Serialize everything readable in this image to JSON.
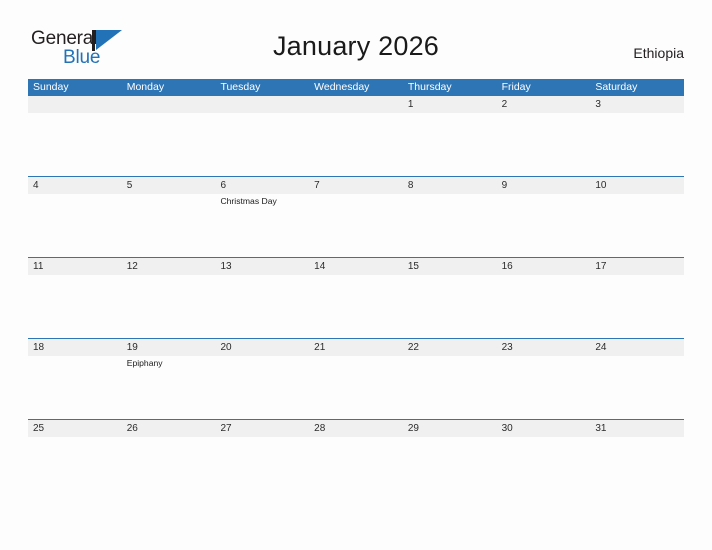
{
  "brand": {
    "name_part1": "General",
    "name_part2": "Blue",
    "flag_color": "#2272b8",
    "text_color": "#231f20"
  },
  "header": {
    "title": "January 2026",
    "locale": "Ethiopia"
  },
  "calendar": {
    "header_bg": "#2e75b6",
    "band_bg": "#f0f0f0",
    "weekdays": [
      "Sunday",
      "Monday",
      "Tuesday",
      "Wednesday",
      "Thursday",
      "Friday",
      "Saturday"
    ],
    "weeks": [
      {
        "days": [
          {
            "number": "",
            "event": ""
          },
          {
            "number": "",
            "event": ""
          },
          {
            "number": "",
            "event": ""
          },
          {
            "number": "",
            "event": ""
          },
          {
            "number": "1",
            "event": ""
          },
          {
            "number": "2",
            "event": ""
          },
          {
            "number": "3",
            "event": ""
          }
        ]
      },
      {
        "days": [
          {
            "number": "4",
            "event": ""
          },
          {
            "number": "5",
            "event": ""
          },
          {
            "number": "6",
            "event": "Christmas Day"
          },
          {
            "number": "7",
            "event": ""
          },
          {
            "number": "8",
            "event": ""
          },
          {
            "number": "9",
            "event": ""
          },
          {
            "number": "10",
            "event": ""
          }
        ]
      },
      {
        "days": [
          {
            "number": "11",
            "event": ""
          },
          {
            "number": "12",
            "event": ""
          },
          {
            "number": "13",
            "event": ""
          },
          {
            "number": "14",
            "event": ""
          },
          {
            "number": "15",
            "event": ""
          },
          {
            "number": "16",
            "event": ""
          },
          {
            "number": "17",
            "event": ""
          }
        ]
      },
      {
        "days": [
          {
            "number": "18",
            "event": ""
          },
          {
            "number": "19",
            "event": "Epiphany"
          },
          {
            "number": "20",
            "event": ""
          },
          {
            "number": "21",
            "event": ""
          },
          {
            "number": "22",
            "event": ""
          },
          {
            "number": "23",
            "event": ""
          },
          {
            "number": "24",
            "event": ""
          }
        ]
      },
      {
        "days": [
          {
            "number": "25",
            "event": ""
          },
          {
            "number": "26",
            "event": ""
          },
          {
            "number": "27",
            "event": ""
          },
          {
            "number": "28",
            "event": ""
          },
          {
            "number": "29",
            "event": ""
          },
          {
            "number": "30",
            "event": ""
          },
          {
            "number": "31",
            "event": ""
          }
        ]
      }
    ]
  }
}
